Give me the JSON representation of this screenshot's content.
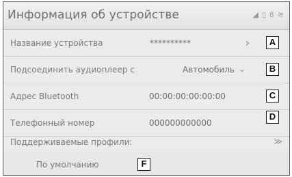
{
  "header": {
    "title": "Информация об устройстве",
    "status_icons": [
      "signal-icon",
      "phone-icon",
      "bluetooth-icon",
      "wifi-icon"
    ]
  },
  "rows": [
    {
      "label": "Название устройства",
      "value": "**********",
      "control": "arrow",
      "callout": "A"
    },
    {
      "label": "Подсоединить аудиоплеер с",
      "value": "Автомобиль",
      "control": "dropdown",
      "callout": "B"
    },
    {
      "label": "Адрес Bluetooth",
      "value": "00:00:00:00:00:00",
      "control": "none",
      "callout": "C"
    },
    {
      "label": "Телефонный номер",
      "value": "000000000000",
      "control": "none",
      "callout": "D"
    }
  ],
  "profiles": {
    "label": "Поддерживаемые профили:",
    "items": [
      {
        "label": "По умолчанию",
        "callout": "F"
      }
    ]
  },
  "glyphs": {
    "arrow": "›",
    "dropdown": "⌄",
    "expand": "≫"
  },
  "colors": {
    "background": "#ebebeb",
    "border": "#5a5a5a",
    "text": "#777777"
  }
}
